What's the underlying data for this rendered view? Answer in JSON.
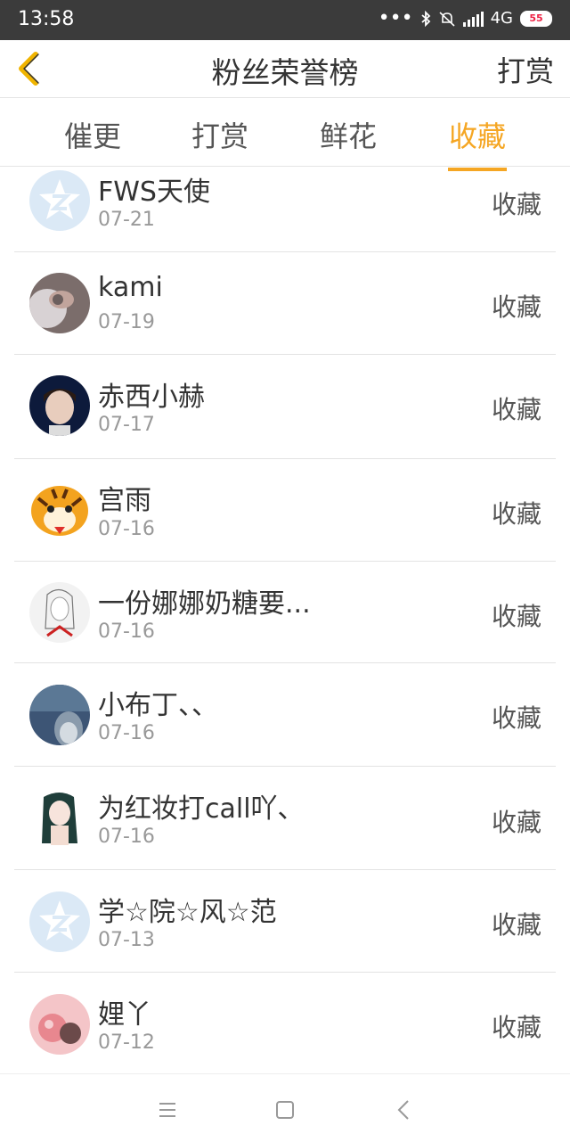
{
  "status_bar": {
    "time": "13:58",
    "network": "4G",
    "battery": "55"
  },
  "header": {
    "title": "粉丝荣誉榜",
    "right_action": "打赏"
  },
  "tabs": [
    {
      "label": "催更",
      "active": false
    },
    {
      "label": "打赏",
      "active": false
    },
    {
      "label": "鲜花",
      "active": false
    },
    {
      "label": "收藏",
      "active": true
    }
  ],
  "accent_color": "#f5a623",
  "rows": [
    {
      "name": "FWS天使",
      "date": "07-21",
      "action": "收藏",
      "avatar": "qq-default"
    },
    {
      "name": "kami",
      "date": "07-19",
      "action": "收藏",
      "avatar": "hand-photo"
    },
    {
      "name": "赤西小赫",
      "date": "07-17",
      "action": "收藏",
      "avatar": "person-photo"
    },
    {
      "name": "宫雨",
      "date": "07-16",
      "action": "收藏",
      "avatar": "tiger-cartoon"
    },
    {
      "name": "一份娜娜奶糖要...",
      "date": "07-16",
      "action": "收藏",
      "avatar": "sketch-girl"
    },
    {
      "name": "小布丁、、",
      "date": "07-16",
      "action": "收藏",
      "avatar": "totoro"
    },
    {
      "name": "为红妆打call吖、",
      "date": "07-16",
      "action": "收藏",
      "avatar": "anime-girl"
    },
    {
      "name": "学☆院☆风☆范",
      "date": "07-13",
      "action": "收藏",
      "avatar": "qq-default"
    },
    {
      "name": "娌丫",
      "date": "07-12",
      "action": "收藏",
      "avatar": "pink-photo"
    }
  ],
  "nav_bar": {
    "icons": [
      "menu-icon",
      "home-icon",
      "back-icon"
    ]
  }
}
